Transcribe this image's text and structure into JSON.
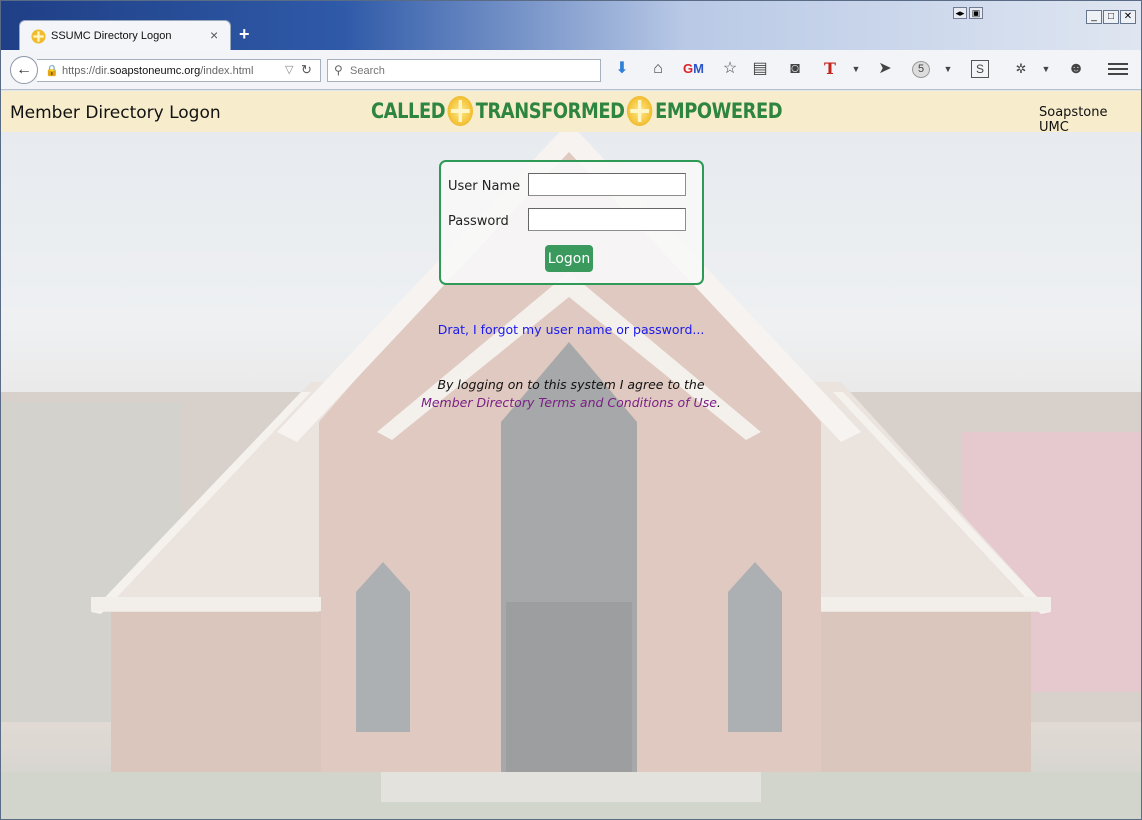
{
  "browser": {
    "tab_title": "SSUMC Directory Logon",
    "tab_close": "×",
    "new_tab": "+",
    "url_prefix": "https://dir.",
    "url_domain": "soapstoneumc.org",
    "url_path": "/index.html",
    "search_placeholder": "Search",
    "badge_count": "5",
    "toolbar_icons": [
      "download-icon",
      "home-icon",
      "gm-icon",
      "bookmark-star-icon",
      "reader-icon",
      "pocket-icon",
      "t-icon",
      "send-icon",
      "badge-icon",
      "s-icon",
      "extension-icon",
      "chat-icon",
      "menu-icon"
    ]
  },
  "header": {
    "left_title": "Member Directory Logon",
    "motto": [
      "CALLED",
      "TRANSFORMED",
      "EMPOWERED"
    ],
    "right_title": "Soapstone UMC"
  },
  "login": {
    "username_label": "User Name",
    "password_label": "Password",
    "username_value": "",
    "password_value": "",
    "button_label": "Logon"
  },
  "links": {
    "forgot": "Drat, I forgot my user name or password...",
    "agree_text": "By logging on to this system I agree to the",
    "terms_link": "Member Directory Terms and Conditions of Use",
    "terms_suffix": "."
  },
  "colors": {
    "accent_green": "#2f9a55",
    "header_bg": "#f7edcc",
    "link_blue": "#1a1aee",
    "visited_purple": "#7a1f86"
  }
}
